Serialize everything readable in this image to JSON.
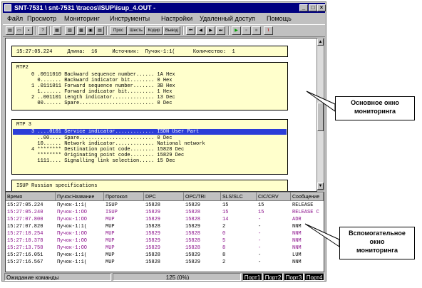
{
  "window": {
    "title": "SNT-7531 \\ snt-7531 \\tracos\\ISUP\\isup_4.OUT -",
    "min_glyph": "_",
    "max_glyph": "□",
    "close_glyph": "×"
  },
  "menu": [
    "Файл",
    "Просмотр",
    "Мониторинг",
    "Инструменты",
    "Настройки",
    "Удаленный доступ",
    "Помощь"
  ],
  "toolbar_text_buttons": [
    "Прос",
    "Шесть",
    "Кодир",
    "Вывод"
  ],
  "toolbar_media_glyphs": [
    "⏮",
    "◀",
    "▶",
    "⏭",
    "▶",
    "⏸",
    "■",
    "\\"
  ],
  "scroll": {
    "up": "▲",
    "down": "▼"
  },
  "main": {
    "summary_line": "15:27:05.224     Длина:  16     Источник:  Пучок-1:1(      Количество:  1",
    "mtp2": {
      "header": "MTP2",
      "lines": [
        "     0 .0011010 Backward sequence number...... 1A Hex",
        "       0....... Backward indicator bit........ 0 Hex",
        "     1 .0111011 Forward sequence number....... 3B Hex",
        "       1....... Forward indicator bit......... 1 Hex",
        "     2 ..001101 Length indicator.............. 13 Dec",
        "       00...... Spare......................... 0 Dec"
      ]
    },
    "mtp3": {
      "header": "MTP 3",
      "highlight": "     3 ....0101 Service indicator............. ISDN User Part",
      "lines": [
        "       ..00.... Spare......................... 0 Dec",
        "       10...... Network indicator............. National network",
        "     4 ******** Destination point code........ 15828 Dec",
        "       ******** Originating point code........ 15829 Dec",
        "       1111.... Signalling link selection..... 15 Dec"
      ]
    },
    "isup": {
      "header": "ISUP Russian specifications"
    }
  },
  "grid": {
    "columns": [
      "Время",
      "Пучок:Название",
      "Протокол",
      "DPC",
      "OPC/TRI",
      "SLS/SLC",
      "CIC/CRV",
      "Сообщение"
    ],
    "rows": [
      [
        "15:27:05.224",
        "Пучок-1:1(",
        "ISUP",
        "15828",
        "15829",
        "15",
        "15",
        "RELEASE"
      ],
      [
        "15:27:05.240",
        "Пучок-1:ОО",
        "ISUP",
        "15829",
        "15828",
        "15",
        "15",
        "RELEASE C"
      ],
      [
        "15:27:07.800",
        "Пучок-1:ОО",
        "MUP",
        "15829",
        "15828",
        "14",
        "-",
        "ADR"
      ],
      [
        "15:27:07.820",
        "Пучок-1:1(",
        "MUP",
        "15828",
        "15829",
        "2",
        "-",
        "NNM"
      ],
      [
        "15:27:10.254",
        "Пучок-1:ОО",
        "MUP",
        "15829",
        "15828",
        "0",
        "-",
        "NNM"
      ],
      [
        "15:27:10.378",
        "Пучок-1:ОО",
        "MUP",
        "15829",
        "15828",
        "5",
        "-",
        "NNM"
      ],
      [
        "15:27:13.758",
        "Пучок-1:ОО",
        "MUP",
        "15829",
        "15828",
        "8",
        "-",
        "NNM"
      ],
      [
        "15:27:16.051",
        "Пучок-1:1(",
        "MUP",
        "15828",
        "15829",
        "8",
        "-",
        "LUM"
      ],
      [
        "15:27:16.567",
        "Пучок-1:1(",
        "MUP",
        "15828",
        "15829",
        "2",
        "-",
        "NNM"
      ]
    ],
    "row_colors": [
      "#000000",
      "#8a0f8a",
      "#8a0f8a",
      "#000000",
      "#8a0f8a",
      "#8a0f8a",
      "#8a0f8a",
      "#000000",
      "#000000"
    ]
  },
  "status": {
    "message": "Ожидание команды",
    "progress": "125 (0%)",
    "ports": [
      "Порт1",
      "Порт2",
      "Порт3",
      "Порт4"
    ]
  },
  "callouts": {
    "main": [
      "Основное окно",
      "мониторинга"
    ],
    "aux": [
      "Вспомогательное",
      "окно",
      "мониторинга"
    ]
  },
  "colors": {
    "titlebar": "#000080",
    "highlight": "#2b3dd8",
    "box": "#ffffcc",
    "run_green": "#00a000"
  }
}
